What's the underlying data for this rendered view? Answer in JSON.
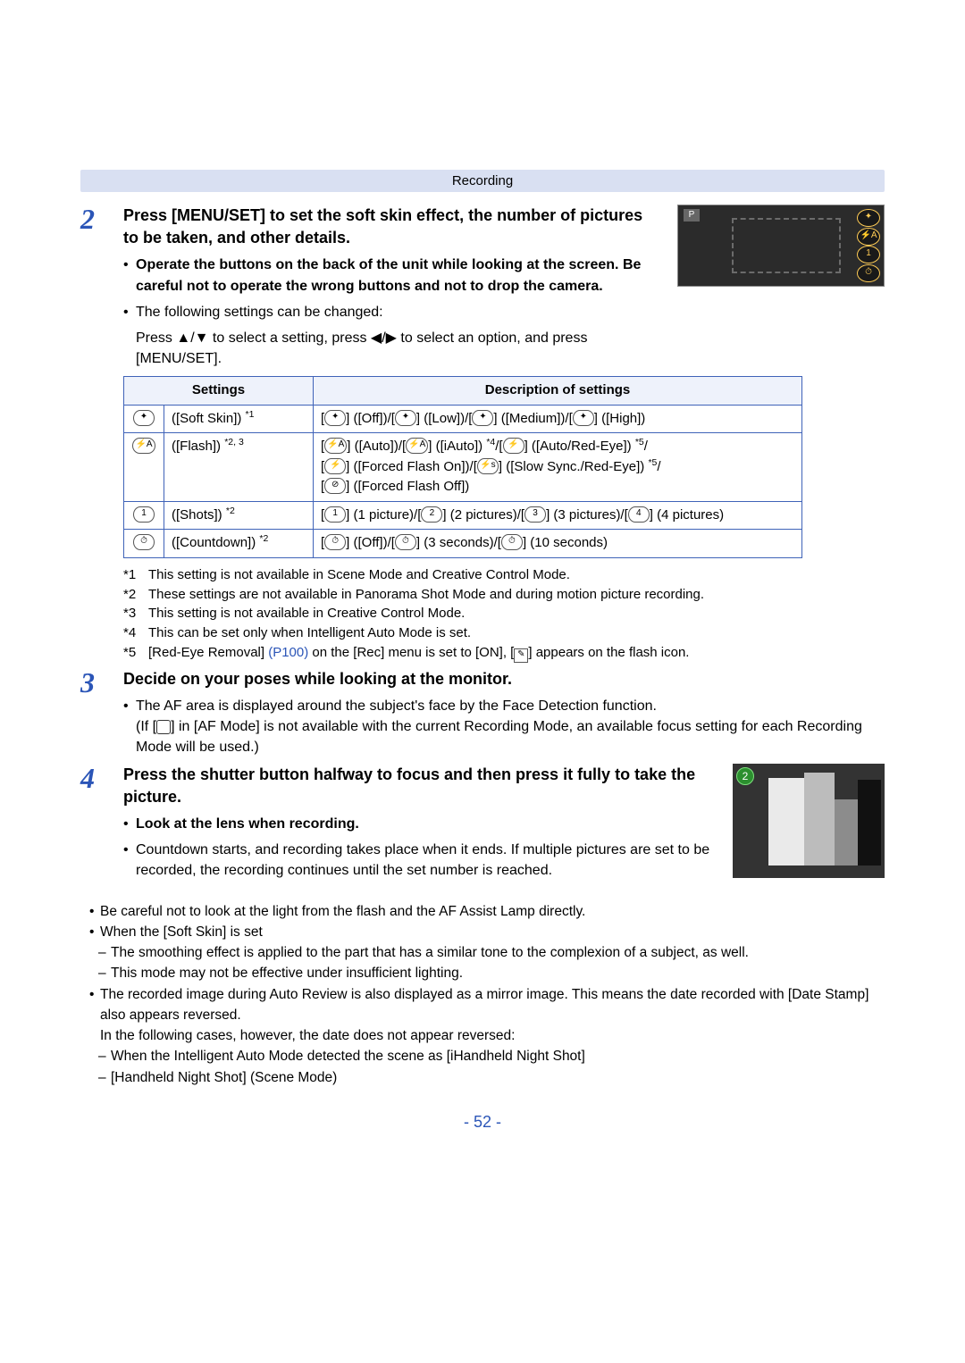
{
  "header": {
    "section_label": "Recording"
  },
  "step2": {
    "title": "Press [MENU/SET] to set the soft skin effect, the number of pictures to be taken, and other details.",
    "bold_bullet": "Operate the buttons on the back of the unit while looking at the screen. Be careful not to operate the wrong buttons and not to drop the camera.",
    "plain_bullet": "The following settings can be changed:",
    "press_line_a": "Press ",
    "press_line_b": "/",
    "press_line_c": " to select a setting, press ",
    "press_line_d": "/",
    "press_line_e": " to select an option, and press [MENU/SET]."
  },
  "table": {
    "head_settings": "Settings",
    "head_desc": "Description of settings",
    "rows": [
      {
        "setting": "([Soft Skin])",
        "sup": "*1",
        "desc": "[ ] ([Off])/[ ] ([Low])/[ ] ([Medium])/[ ] ([High])"
      },
      {
        "setting": "([Flash])",
        "sup": "*2, 3",
        "desc_line1": "[ ] ([Auto])/[ ] ([iAuto]) *4/[ ] ([Auto/Red-Eye]) *5/",
        "desc_line2": "[ ] ([Forced Flash On])/[ ] ([Slow Sync./Red-Eye]) *5/",
        "desc_line3": "[ ] ([Forced Flash Off])"
      },
      {
        "setting": "([Shots])",
        "sup": "*2",
        "desc": "[ ] (1 picture)/[ ] (2 pictures)/[ ] (3 pictures)/[ ] (4 pictures)"
      },
      {
        "setting": "([Countdown])",
        "sup": "*2",
        "desc": "[ ] ([Off])/[ ] (3 seconds)/[ ] (10 seconds)"
      }
    ]
  },
  "footnotes": {
    "f1": "This setting is not available in Scene Mode and Creative Control Mode.",
    "f2": "These settings are not available in Panorama Shot Mode and during motion picture recording.",
    "f3": "This setting is not available in Creative Control Mode.",
    "f4": "This can be set only when Intelligent Auto Mode is set.",
    "f5a": "[Red-Eye Removal] ",
    "f5_link": "(P100)",
    "f5b": " on the [Rec] menu is set to [ON], [",
    "f5c": "] appears on the flash icon."
  },
  "step3": {
    "title": "Decide on your poses while looking at the monitor.",
    "bullet_a": "The AF area is displayed around the subject's face by the Face Detection function.",
    "bullet_b1": "(If [",
    "bullet_b2": "] in [AF Mode] is not available with the current Recording Mode, an available focus setting for each Recording Mode will be used.)"
  },
  "step4": {
    "title": "Press the shutter button halfway to focus and then press it fully to take the picture.",
    "bold_bullet": "Look at the lens when recording.",
    "plain_bullet": "Countdown starts, and recording takes place when it ends. If multiple pictures are set to be recorded, the recording continues until the set number is reached."
  },
  "notes": {
    "n1": "Be careful not to look at the light from the flash and the AF Assist Lamp directly.",
    "n2": "When the [Soft Skin] is set",
    "n2a": "The smoothing effect is applied to the part that has a similar tone to the complexion of a subject, as well.",
    "n2b": "This mode may not be effective under insufficient lighting.",
    "n3": "The recorded image during Auto Review is also displayed as a mirror image. This means the date recorded with [Date Stamp] also appears reversed.",
    "n3a": "In the following cases, however, the date does not appear reversed:",
    "n3b": "When the Intelligent Auto Mode detected the scene as [iHandheld Night Shot]",
    "n3c": "[Handheld Night Shot] (Scene Mode)"
  },
  "page_number": "- 52 -"
}
